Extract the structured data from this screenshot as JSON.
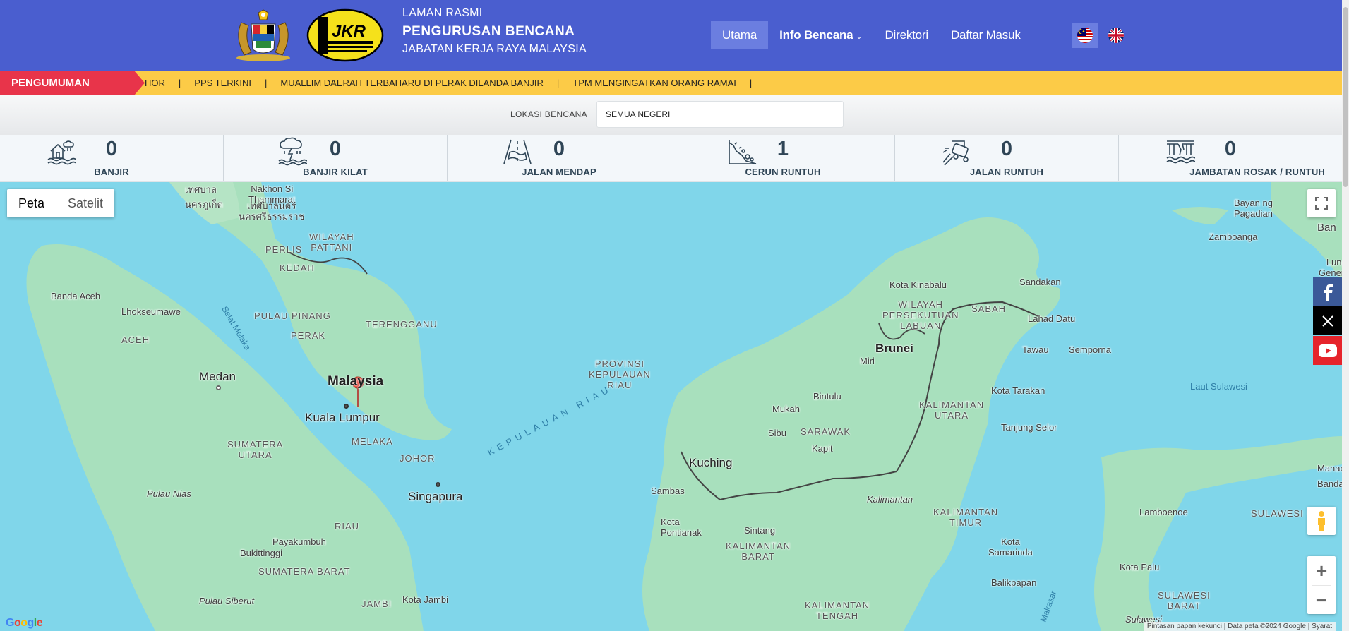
{
  "header": {
    "title_line1": "LAMAN RASMI",
    "title_line2": "PENGURUSAN BENCANA",
    "title_line3": "JABATAN KERJA RAYA MALAYSIA",
    "jkr_logo_text": "JKR",
    "nav": [
      {
        "label": "Utama",
        "active": true
      },
      {
        "label": "Info Bencana",
        "dropdown": true
      },
      {
        "label": "Direktori"
      },
      {
        "label": "Daftar Masuk"
      }
    ],
    "languages": [
      "ms",
      "en"
    ]
  },
  "announcement": {
    "tag": "PENGUMUMAN",
    "items": [
      "HOR",
      "PPS TERKINI",
      "MUALLIM DAERAH TERBAHARU DI PERAK DILANDA BANJIR",
      "TPM MENGINGATKAN ORANG RAMAI"
    ],
    "separator": "|"
  },
  "filter": {
    "label": "LOKASI BENCANA",
    "value": "SEMUA NEGERI"
  },
  "stats": [
    {
      "label": "BANJIR",
      "value": "0",
      "icon": "flood-house-icon"
    },
    {
      "label": "BANJIR KILAT",
      "value": "0",
      "icon": "flash-flood-icon"
    },
    {
      "label": "JALAN MENDAP",
      "value": "0",
      "icon": "sinking-road-icon"
    },
    {
      "label": "CERUN RUNTUH",
      "value": "1",
      "icon": "landslide-icon"
    },
    {
      "label": "JALAN RUNTUH",
      "value": "0",
      "icon": "road-collapse-icon"
    },
    {
      "label": "JAMBATAN ROSAK / RUNTUH",
      "value": "0",
      "icon": "bridge-damage-icon"
    }
  ],
  "map": {
    "type_map": "Peta",
    "type_satellite": "Satelit",
    "attribution": "Pintasan papan kekunci  |  Data peta ©2024 Google  |  Syarat",
    "google": "Google",
    "labels": {
      "malaysia": "Malaysia",
      "kuala_lumpur": "Kuala Lumpur",
      "singapura": "Singapura",
      "brunei": "Brunei",
      "kuching": "Kuching",
      "medan": "Medan",
      "banda_aceh": "Banda Aceh",
      "lhokseumawe": "Lhokseumawe",
      "aceh": "ACEH",
      "sumatera_utara": "SUMATERA\nUTARA",
      "perlis": "PERLIS",
      "kedah": "KEDAH",
      "pulau_pinang": "PULAU PINANG",
      "perak": "PERAK",
      "terengganu": "TERENGGANU",
      "melaka": "MELAKA",
      "johor": "JOHOR",
      "wilayah_pattani": "WILAYAH\nPATTANI",
      "nakhon": "Nakhon Si\nThammarat",
      "selat_melaka": "Selat Melaka",
      "kepulauan_riau": "KEPULAUAN RIAU",
      "provinsi_kepri": "PROVINSI\nKEPULAUAN\nRIAU",
      "riau": "RIAU",
      "pulau_nias": "Pulau Nias",
      "payakumbuh": "Payakumbuh",
      "bukittinggi": "Bukittinggi",
      "sumatera_barat": "SUMATERA BARAT",
      "pulau_siberut": "Pulau Siberut",
      "jambi": "JAMBI",
      "kota_jambi": "Kota Jambi",
      "kota_kinabalu": "Kota Kinabalu",
      "sandakan": "Sandakan",
      "sabah": "SABAH",
      "wilayah_labuan": "WILAYAH\nPERSEKUTUAN\nLABUAN",
      "lahad_datu": "Lahad Datu",
      "tawau": "Tawau",
      "semporna": "Semporna",
      "miri": "Miri",
      "bintulu": "Bintulu",
      "mukah": "Mukah",
      "sibu": "Sibu",
      "sarawak": "SARAWAK",
      "kapit": "Kapit",
      "kalimantan_utara": "KALIMANTAN\nUTARA",
      "kota_tarakan": "Kota Tarakan",
      "tanjung_selor": "Tanjung Selor",
      "sambas": "Sambas",
      "kota_pontianak": "Kota\nPontianak",
      "sintang": "Sintang",
      "kalimantan_barat": "KALIMANTAN\nBARAT",
      "kalimantan": "Kalimantan",
      "kalimantan_timur": "KALIMANTAN\nTIMUR",
      "kota_samarinda": "Kota\nSamarinda",
      "balikpapan": "Balikpapan",
      "kalimantan_tengah": "KALIMANTAN\nTENGAH",
      "laut_sulawesi": "Laut Sulawesi",
      "zamboanga": "Zamboanga",
      "bayan": "Bayan ng\nPagadian",
      "ban": "Ban",
      "lungs": "Lungs\nGeneral",
      "lamboenoe": "Lamboenoe",
      "sulawesi_utara": "SULAWESI U",
      "manad": "Manad",
      "bandar": "Bandar",
      "kota_palu": "Kota Palu",
      "sulawesi_barat": "SULAWESI\nBARAT",
      "sulawesi": "Sulawesi",
      "makasar": "Makasar",
      "thai_top": "เทศบาล\nนครภูเก็ต",
      "thai_nakhon": "เทศบาลนคร\nนครศรีธรรมราช"
    }
  },
  "social": [
    "facebook",
    "x",
    "youtube"
  ]
}
